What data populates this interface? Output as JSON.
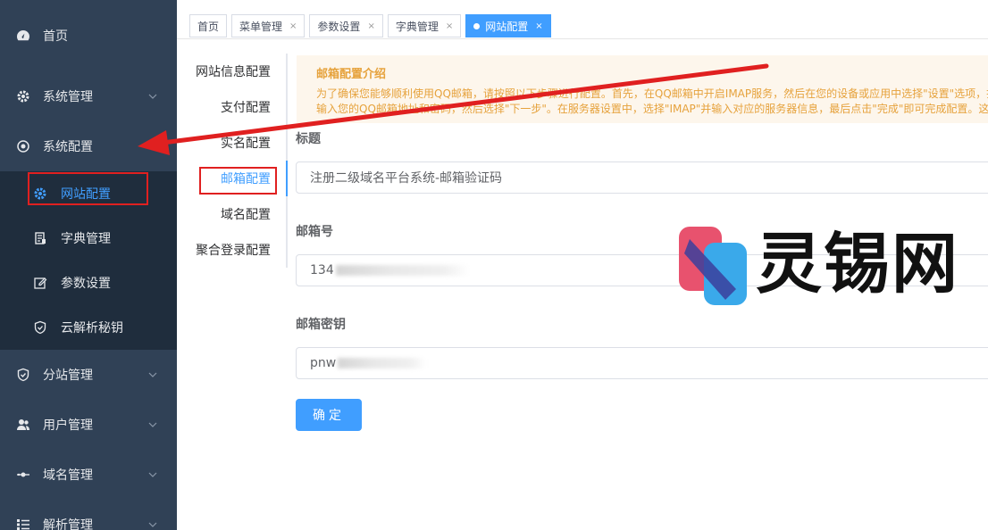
{
  "sidebar": {
    "items": [
      {
        "label": "首页",
        "icon": "dashboard-icon"
      },
      {
        "label": "系统管理",
        "icon": "gear-icon"
      },
      {
        "label": "系统配置",
        "icon": "target-icon"
      },
      {
        "label": "分站管理",
        "icon": "shield-check-icon"
      },
      {
        "label": "用户管理",
        "icon": "users-icon"
      },
      {
        "label": "域名管理",
        "icon": "link-icon"
      },
      {
        "label": "解析管理",
        "icon": "list-icon"
      }
    ],
    "submenu": [
      {
        "label": "网站配置",
        "icon": "gear-icon",
        "active": true
      },
      {
        "label": "字典管理",
        "icon": "document-icon"
      },
      {
        "label": "参数设置",
        "icon": "edit-icon"
      },
      {
        "label": "云解析秘钥",
        "icon": "shield-icon"
      }
    ]
  },
  "tags": [
    {
      "label": "首页"
    },
    {
      "label": "菜单管理",
      "close": "×"
    },
    {
      "label": "参数设置",
      "close": "×"
    },
    {
      "label": "字典管理",
      "close": "×"
    },
    {
      "label": "网站配置",
      "close": "×",
      "active": true
    }
  ],
  "secondary_nav": [
    {
      "label": "网站信息配置"
    },
    {
      "label": "支付配置"
    },
    {
      "label": "实名配置"
    },
    {
      "label": "邮箱配置",
      "active": true
    },
    {
      "label": "域名配置"
    },
    {
      "label": "聚合登录配置"
    }
  ],
  "alert": {
    "title": "邮箱配置介绍",
    "line1": "为了确保您能够顺利使用QQ邮箱，请按照以下步骤进行配置。首先，在QQ邮箱中开启IMAP服务，然后在您的设备或应用中选择\"设置\"选项，找",
    "line2": "输入您的QQ邮箱地址和密码，然后选择\"下一步\"。在服务器设置中，选择\"IMAP\"并输入对应的服务器信息，最后点击\"完成\"即可完成配置。这样"
  },
  "form": {
    "title_label": "标题",
    "title_value": "注册二级域名平台系统-邮箱验证码",
    "email_label": "邮箱号",
    "email_value": "134",
    "key_label": "邮箱密钥",
    "key_value": "pnw",
    "submit_label": "确定"
  },
  "watermark": {
    "text": "灵锡网"
  },
  "colors": {
    "sidebar_bg": "#304156",
    "submenu_bg": "#1f2d3d",
    "primary": "#409eff",
    "alert_text": "#e6a23c",
    "highlight_red": "#e02020"
  }
}
